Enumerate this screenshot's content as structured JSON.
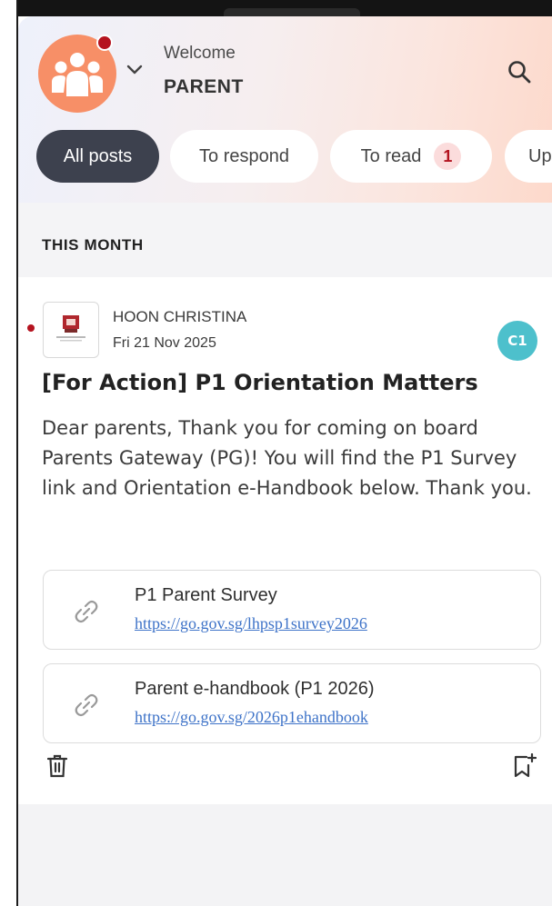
{
  "header": {
    "welcome": "Welcome",
    "role": "PARENT"
  },
  "tabs": [
    {
      "label": "All posts",
      "active": true
    },
    {
      "label": "To respond",
      "active": false
    },
    {
      "label": "To read",
      "active": false,
      "badge": "1"
    },
    {
      "label": "Up",
      "active": false
    }
  ],
  "section": {
    "label": "THIS MONTH"
  },
  "post": {
    "sender": "HOON CHRISTINA",
    "date": "Fri 21 Nov 2025",
    "avatar_initials": "C1",
    "title": "[For Action] P1 Orientation Matters",
    "body": "Dear parents, Thank you for coming on board Parents Gateway (PG)! You will find the P1 Survey link and Orientation e-Handbook below. Thank you.",
    "links": [
      {
        "name": "P1 Parent Survey",
        "url": "https://go.gov.sg/lhpsp1survey2026"
      },
      {
        "name": "Parent e-handbook (P1 2026)",
        "url": "https://go.gov.sg/2026p1ehandbook"
      }
    ]
  },
  "colors": {
    "accent_orange": "#f78f67",
    "unread_red": "#b5131f",
    "active_tab": "#3d414e",
    "avatar_teal": "#4dc0cc",
    "link_blue": "#3e73c8"
  },
  "icons": [
    "family-avatar-icon",
    "chevron-down-icon",
    "search-icon",
    "link-icon",
    "trash-icon",
    "bookmark-add-icon"
  ]
}
